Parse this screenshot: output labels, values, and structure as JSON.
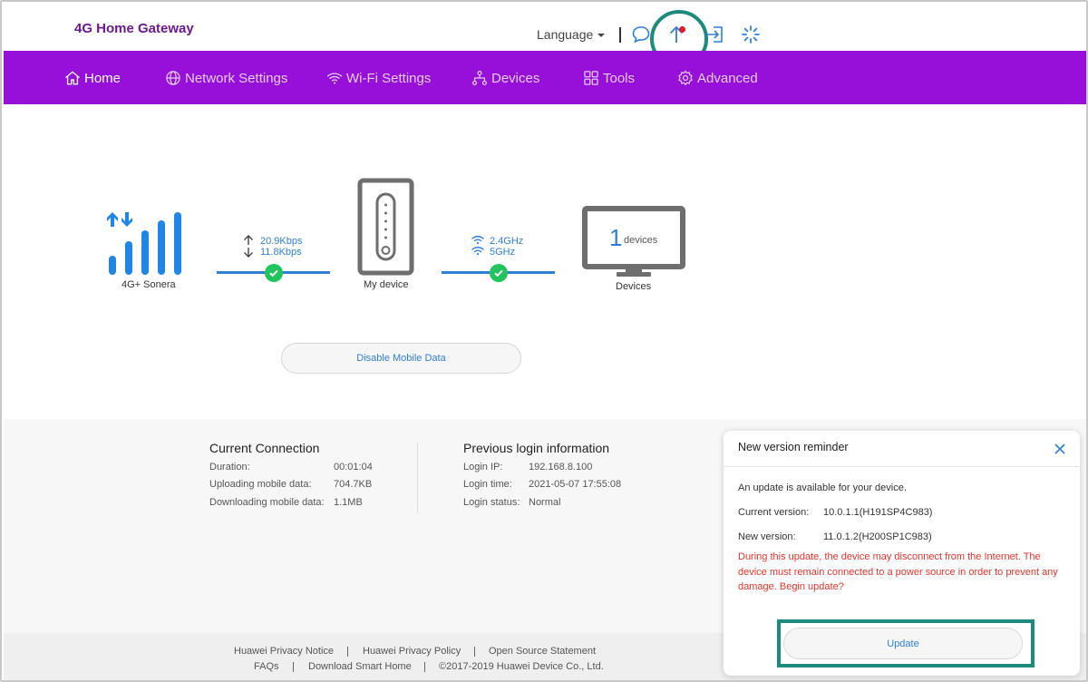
{
  "header": {
    "brand": "4G Home Gateway",
    "language_label": "Language",
    "icons": [
      "message-icon",
      "update-icon",
      "logout-icon",
      "loading-icon"
    ]
  },
  "nav": {
    "items": [
      {
        "label": "Home",
        "icon": "home-icon",
        "active": true
      },
      {
        "label": "Network Settings",
        "icon": "globe-icon"
      },
      {
        "label": "Wi-Fi Settings",
        "icon": "wifi-icon"
      },
      {
        "label": "Devices",
        "icon": "devices-icon"
      },
      {
        "label": "Tools",
        "icon": "tools-icon"
      },
      {
        "label": "Advanced",
        "icon": "gear-icon"
      }
    ]
  },
  "status": {
    "network_name": "4G+ Sonera",
    "upload_speed": "20.9Kbps",
    "download_speed": "11.8Kbps",
    "my_device_label": "My device",
    "wifi_band_1": "2.4GHz",
    "wifi_band_2": "5GHz",
    "device_count": "1",
    "device_count_unit": "devices",
    "devices_label": "Devices",
    "disable_mobile_data": "Disable Mobile Data"
  },
  "current_connection": {
    "title": "Current Connection",
    "rows": [
      {
        "key": "Duration:",
        "value": "00:01:04"
      },
      {
        "key": "Uploading mobile data:",
        "value": "704.7KB"
      },
      {
        "key": "Downloading mobile data:",
        "value": "1.1MB"
      }
    ]
  },
  "previous_login": {
    "title": "Previous login information",
    "rows": [
      {
        "key": "Login IP:",
        "value": "192.168.8.100"
      },
      {
        "key": "Login time:",
        "value": "2021-05-07 17:55:08"
      },
      {
        "key": "Login status:",
        "value": "Normal"
      }
    ]
  },
  "footer": {
    "links_row1": [
      "Huawei Privacy Notice",
      "Huawei Privacy Policy",
      "Open Source Statement"
    ],
    "links_row2": [
      "FAQs",
      "Download Smart Home"
    ],
    "copyright": "©2017-2019 Huawei Device Co., Ltd."
  },
  "dialog": {
    "title": "New version reminder",
    "message": "An update is available for your device.",
    "current_version_label": "Current version:",
    "current_version": "10.0.1.1(H191SP4C983)",
    "new_version_label": "New version:",
    "new_version": "11.0.1.2(H200SP1C983)",
    "warning": "During this update, the device may disconnect from the Internet. The device must remain connected to a power source in order to prevent any damage. Begin update?",
    "update_button": "Update"
  },
  "colors": {
    "nav_bg": "#9610d9",
    "brand": "#6b1a8f",
    "accent_blue": "#2f7fd8",
    "highlight_teal": "#1d8a7e",
    "success_green": "#21c55d",
    "warning_red": "#e8342a"
  }
}
